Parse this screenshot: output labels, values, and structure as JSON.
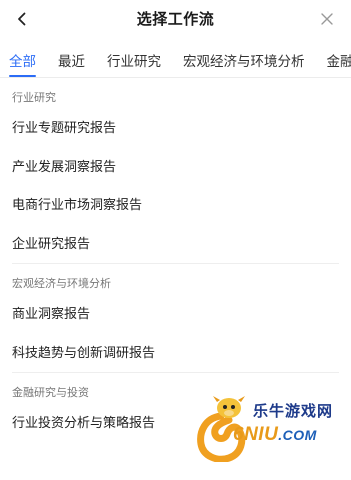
{
  "header": {
    "title": "选择工作流"
  },
  "tabs": [
    {
      "label": "全部",
      "active": true
    },
    {
      "label": "最近",
      "active": false
    },
    {
      "label": "行业研究",
      "active": false
    },
    {
      "label": "宏观经济与环境分析",
      "active": false
    },
    {
      "label": "金融研究与投资",
      "active": false
    }
  ],
  "sections": [
    {
      "title": "行业研究",
      "items": [
        "行业专题研究报告",
        "产业发展洞察报告",
        "电商行业市场洞察报告",
        "企业研究报告"
      ]
    },
    {
      "title": "宏观经济与环境分析",
      "items": [
        "商业洞察报告",
        "科技趋势与创新调研报告"
      ]
    },
    {
      "title": "金融研究与投资",
      "items": [
        "行业投资分析与策略报告"
      ]
    }
  ],
  "watermark": {
    "brand_cn": "乐牛游戏网",
    "brand_logo": "6NIU",
    "brand_domain": ".COM"
  },
  "colors": {
    "accent": "#2b6cf6",
    "text": "#222222",
    "muted": "#777777"
  },
  "icons": {
    "back": "chevron-left-icon",
    "close": "close-icon"
  }
}
